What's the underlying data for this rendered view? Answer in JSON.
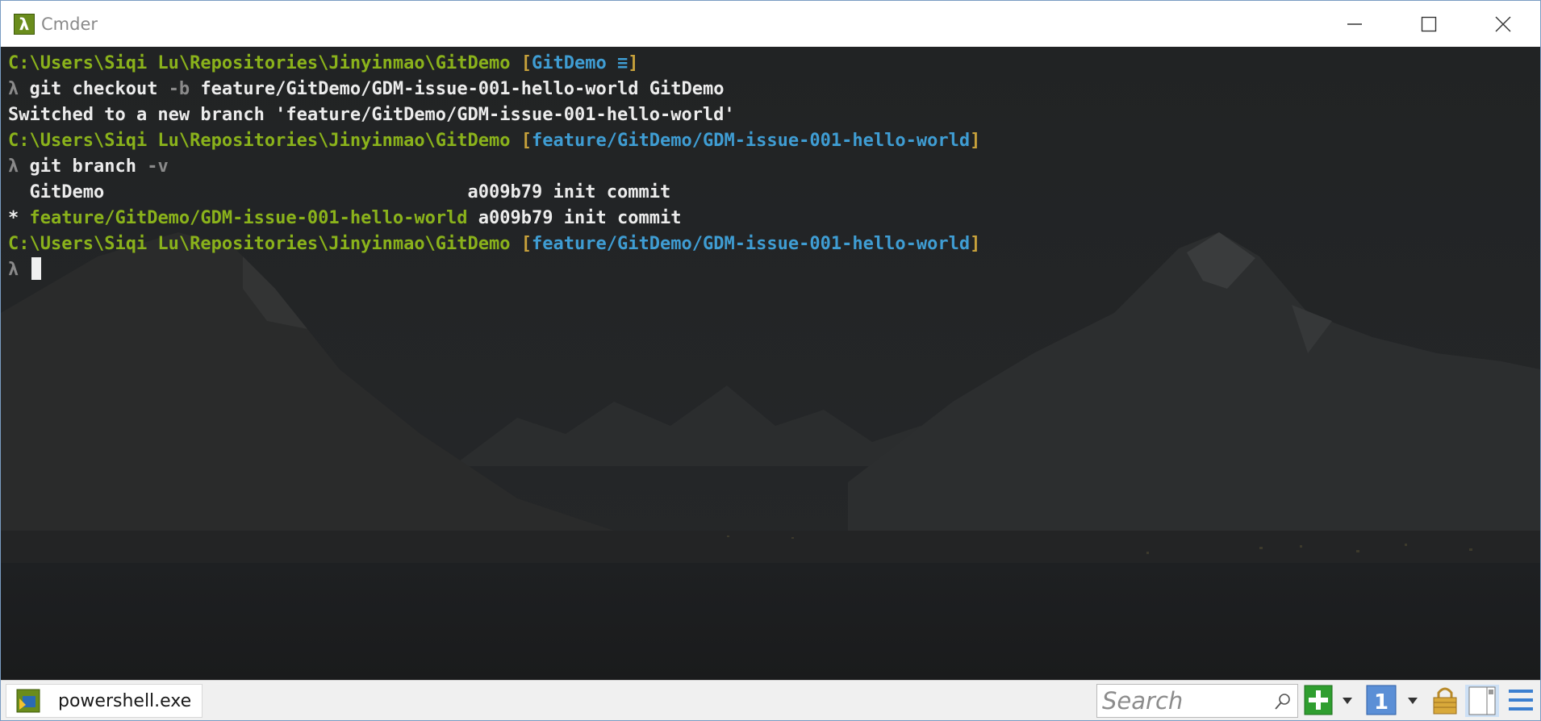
{
  "window": {
    "title": "Cmder",
    "app_icon_glyph": "λ",
    "controls": [
      "minimize-icon",
      "maximize-icon",
      "close-icon"
    ]
  },
  "colors": {
    "path": "#8ab21b",
    "bracket": "#c7a13b",
    "branch": "#3f9dd3",
    "prompt": "#8a8a8a",
    "text": "#ececec",
    "background": "#1f2122"
  },
  "terminal": {
    "lines": [
      [
        {
          "text": "C:\\Users\\Siqi Lu\\Repositories\\Jinyinmao\\GitDemo",
          "color": "green"
        },
        {
          "text": " [",
          "color": "gold"
        },
        {
          "text": "GitDemo ≡",
          "color": "cyan"
        },
        {
          "text": "]",
          "color": "gold"
        }
      ],
      [
        {
          "text": "λ ",
          "color": "gray"
        },
        {
          "text": "git checkout ",
          "color": "white"
        },
        {
          "text": "-b ",
          "color": "gray"
        },
        {
          "text": "feature/GitDemo/GDM-issue-001-hello-world GitDemo",
          "color": "white"
        }
      ],
      [
        {
          "text": "Switched to a new branch 'feature/GitDemo/GDM-issue-001-hello-world'",
          "color": "white"
        }
      ],
      [
        {
          "text": "C:\\Users\\Siqi Lu\\Repositories\\Jinyinmao\\GitDemo",
          "color": "green"
        },
        {
          "text": " [",
          "color": "gold"
        },
        {
          "text": "feature/GitDemo/GDM-issue-001-hello-world",
          "color": "cyan"
        },
        {
          "text": "]",
          "color": "gold"
        }
      ],
      [
        {
          "text": "λ ",
          "color": "gray"
        },
        {
          "text": "git branch ",
          "color": "white"
        },
        {
          "text": "-v",
          "color": "gray"
        }
      ],
      [
        {
          "text": "  GitDemo                                  a009b79 init commit",
          "color": "white"
        }
      ],
      [
        {
          "text": "* ",
          "color": "white"
        },
        {
          "text": "feature/GitDemo/GDM-issue-001-hello-world",
          "color": "green"
        },
        {
          "text": " a009b79 init commit",
          "color": "white"
        }
      ],
      [
        {
          "text": "C:\\Users\\Siqi Lu\\Repositories\\Jinyinmao\\GitDemo",
          "color": "green"
        },
        {
          "text": " [",
          "color": "gold"
        },
        {
          "text": "feature/GitDemo/GDM-issue-001-hello-world",
          "color": "cyan"
        },
        {
          "text": "]",
          "color": "gold"
        }
      ],
      [
        {
          "text": "λ ",
          "color": "gray"
        },
        {
          "text": "",
          "color": "white",
          "cursor": true
        }
      ]
    ]
  },
  "statusbar": {
    "tab_label": "powershell.exe",
    "tab_icon": "powershell-icon",
    "search_placeholder": "Search",
    "search_value": "",
    "buttons": [
      "new-console-icon",
      "dropdown-arrow-icon",
      "console-number-icon",
      "dropdown-arrow-icon",
      "lock-icon",
      "split-panes-icon",
      "menu-icon"
    ],
    "console_number": "1"
  }
}
